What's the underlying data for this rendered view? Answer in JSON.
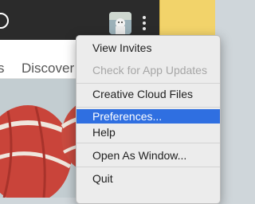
{
  "menu": {
    "items": [
      {
        "label": "View Invites",
        "enabled": true
      },
      {
        "label": "Check for App Updates",
        "enabled": false
      },
      {
        "label": "Creative Cloud Files",
        "enabled": true
      },
      {
        "label": "Preferences...",
        "enabled": true,
        "highlighted": true
      },
      {
        "label": "Help",
        "enabled": true
      },
      {
        "label": "Open As Window...",
        "enabled": true
      },
      {
        "label": "Quit",
        "enabled": true
      }
    ]
  },
  "nav": {
    "discover_label": "Discover",
    "partial_label": "s"
  },
  "colors": {
    "highlight": "#2f6fe1",
    "topbar": "#2b2b2b",
    "yellow_tab": "#f2d36a"
  },
  "icons": {
    "more": "vertical-ellipsis-icon",
    "avatar": "user-avatar"
  }
}
